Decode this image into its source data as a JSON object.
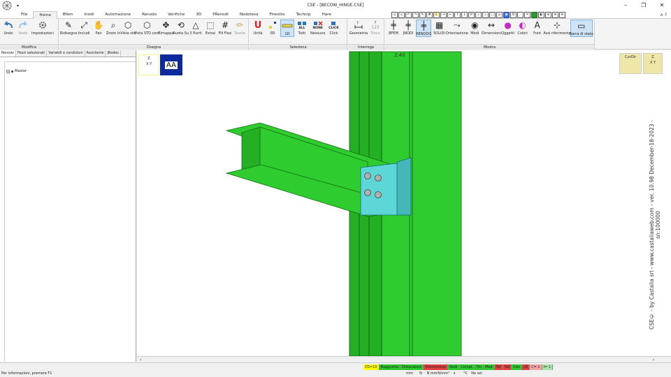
{
  "window": {
    "title": "CSE - [BECOW_HINGE.CSE]",
    "logo_text": "CSE",
    "controls": [
      "–",
      "❐",
      "✕"
    ]
  },
  "menu": {
    "tabs": [
      "File",
      "Home",
      "Bfem",
      "Inodi",
      "Automazione",
      "Renodo",
      "Verifiche",
      "3D",
      "PRenodi",
      "Nodotesa",
      "Finestre",
      "Technip",
      "Hare"
    ],
    "active": "Home",
    "minmax": "∧ ?"
  },
  "ribbon": {
    "groups": [
      {
        "title": "Modifica",
        "buttons": [
          "Undo",
          "Redo",
          "Impostazioni"
        ]
      },
      {
        "title": "Disegna",
        "buttons": [
          "Ridisegna",
          "Includi",
          "Pan",
          "Zoom In",
          "Vista std",
          "Vista STD corr.",
          "Rimappa",
          "Ruota Su",
          "3 Punti",
          "Estrai",
          "Fili Fissi",
          "Tavole"
        ]
      },
      {
        "title": "Seleziona",
        "buttons": [
          "Unità",
          "0D",
          "1D",
          "Tutti",
          "Nessuno",
          "Click"
        ]
      },
      {
        "title": "Interroga",
        "buttons": [
          "Geometria",
          "Trova"
        ]
      },
      {
        "title": "Mostra",
        "buttons": [
          "BFEM",
          "JNODI",
          "RENODO",
          "SOLIDI",
          "Orientazione",
          "Modi",
          "Dimensioni",
          "Oggetti",
          "Colori",
          "Font",
          "Assi riferimento",
          "Barra di stato"
        ]
      }
    ],
    "select_labels": {
      "all": "ALL",
      "none": "NONE",
      "click": "CLICK",
      "trova": "123"
    }
  },
  "left_panel": {
    "tabs": [
      "Renodo",
      "Pezzi selezionati",
      "Variabili e condizioni",
      "Assistente",
      "JNodes"
    ],
    "active_tab": "Renodo",
    "tree_root": "Master"
  },
  "viewport": {
    "axis_z": "Z",
    "axis_xy": "X Y",
    "aa_label": "AA",
    "curdir_label": "CurDir",
    "top_label": "2:40",
    "vertical_text": "CSE© - by Castalia srl - www.castaliaweb.com - ver. 10.98 December-18-2023 - sn:100000",
    "steel_color": "#2ecc2e",
    "plate_color": "#5cd6d6"
  },
  "statusbar": {
    "message": "Per informazioni, premere F1",
    "badges": [
      {
        "label": "DS=10",
        "color": "#ffff00"
      },
      {
        "label": "Raggiunto",
        "color": "#2bc92b"
      },
      {
        "label": "Dislocatore",
        "color": "#2bc92b"
      },
      {
        "label": "Disconnessi",
        "color": "#e04040"
      },
      {
        "label": "Nodi",
        "color": "#2bc92b"
      },
      {
        "label": "Compl.",
        "color": "#2bc92b"
      },
      {
        "label": "Fin",
        "color": "#2bc92b"
      },
      {
        "label": "Med",
        "color": "#2bc92b"
      },
      {
        "label": "Tot",
        "color": "#e04040"
      },
      {
        "label": "Sel",
        "color": "#e04040"
      },
      {
        "label": "Cen",
        "color": "#2bc92b"
      },
      {
        "label": "c8",
        "color": "#e04040"
      },
      {
        "label": "C= 1",
        "color": "#f3a3a3"
      },
      {
        "label": "I= 1",
        "color": "#a8e6a8"
      }
    ],
    "units": [
      "mm",
      "N",
      "N mm",
      "N/mm²",
      "s",
      "°C",
      "No sel"
    ]
  }
}
